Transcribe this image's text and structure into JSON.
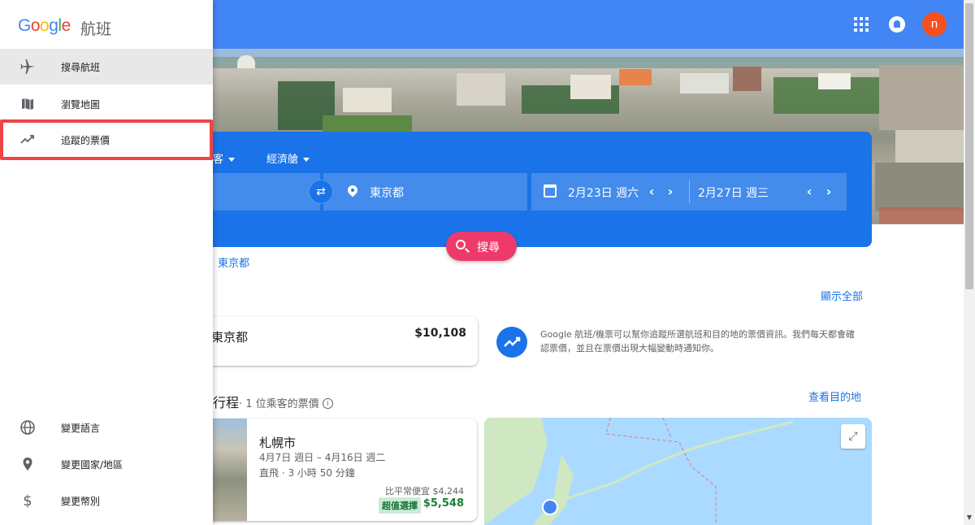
{
  "drawer": {
    "logo_letters": [
      "G",
      "o",
      "o",
      "g",
      "l",
      "e"
    ],
    "product_name": "航班",
    "nav_items": [
      {
        "label": "搜尋航班",
        "icon": "airplane-icon",
        "active": true
      },
      {
        "label": "瀏覽地圖",
        "icon": "map-icon",
        "active": false
      },
      {
        "label": "追蹤的票價",
        "icon": "trending-up-icon",
        "active": false,
        "highlighted": true
      }
    ],
    "footer_items": [
      {
        "label": "變更語言",
        "icon": "globe-icon"
      },
      {
        "label": "變更國家/地區",
        "icon": "location-pin-icon"
      },
      {
        "label": "變更幣別",
        "icon": "dollar-icon"
      }
    ],
    "highlight_color": "#ef4444"
  },
  "topbar": {
    "avatar_letter": "n",
    "color": "#4285f4"
  },
  "search": {
    "passengers_label": "客",
    "cabin_label": "經濟艙",
    "destination": "東京都",
    "depart_date": "2月23日 週六",
    "return_date": "2月27日 週三",
    "search_button": "搜尋",
    "swap_symbol": "⇄",
    "prev_symbol": "‹",
    "next_symbol": "›"
  },
  "recent": {
    "link_text": "東京都",
    "show_all": "顯示全部"
  },
  "tracked": {
    "city": "東京都",
    "price": "$10,108",
    "info_text": "Google 航班/機票可以幫你追蹤所選航班和目的地的票價資訊。我們每天都會確認票價，並且在票價出現大幅變動時通知你。"
  },
  "trips": {
    "title": "行程",
    "subtitle": "· 1 位乘客的票價",
    "info_symbol": "i",
    "view_destinations": "查看目的地",
    "card": {
      "city": "札幌市",
      "dates": "4月7日 週日 – 4月16日 週二",
      "duration": "直飛 · 3 小時 50 分鐘",
      "cheaper_than": "比平常便宜 $4,244",
      "badge": "超值選擇",
      "price": "$5,548"
    },
    "expand_symbol": "⤢"
  }
}
